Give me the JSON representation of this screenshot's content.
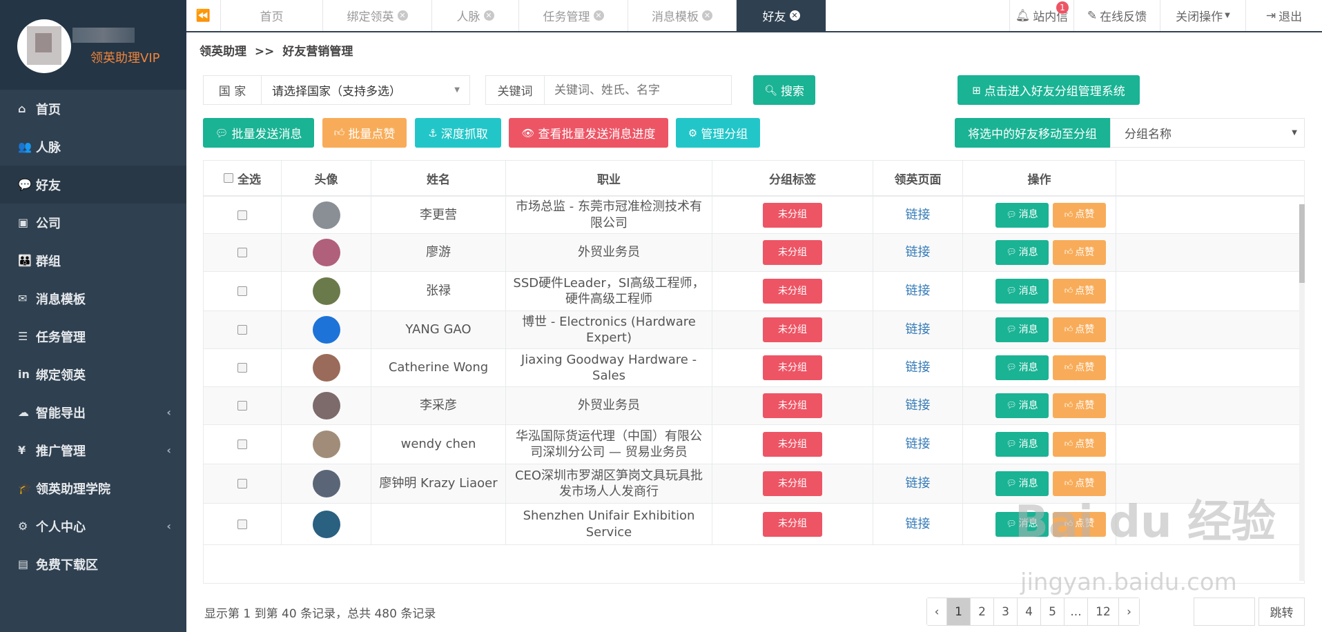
{
  "sidebar": {
    "brand_name": "领英助理VIP",
    "items": [
      {
        "label": "首页",
        "icon": "home-icon",
        "glyph": "⌂"
      },
      {
        "label": "人脉",
        "icon": "user-plus-icon",
        "glyph": "👥"
      },
      {
        "label": "好友",
        "icon": "comments-icon",
        "glyph": "💬",
        "active": true
      },
      {
        "label": "公司",
        "icon": "briefcase-icon",
        "glyph": "▣"
      },
      {
        "label": "群组",
        "icon": "users-icon",
        "glyph": "👪"
      },
      {
        "label": "消息模板",
        "icon": "envelope-icon",
        "glyph": "✉"
      },
      {
        "label": "任务管理",
        "icon": "tasks-icon",
        "glyph": "☰"
      },
      {
        "label": "绑定领英",
        "icon": "linkedin-icon",
        "glyph": "in"
      },
      {
        "label": "智能导出",
        "icon": "cloud-download-icon",
        "glyph": "☁",
        "chevron": true
      },
      {
        "label": "推广管理",
        "icon": "yen-icon",
        "glyph": "¥",
        "chevron": true
      },
      {
        "label": "领英助理学院",
        "icon": "graduation-cap-icon",
        "glyph": "🎓"
      },
      {
        "label": "个人中心",
        "icon": "gear-icon",
        "glyph": "⚙",
        "chevron": true
      },
      {
        "label": "免费下载区",
        "icon": "file-icon",
        "glyph": "▤"
      }
    ]
  },
  "tabs": {
    "back_icon": "⏪",
    "items": [
      "首页",
      "绑定领英",
      "人脉",
      "任务管理",
      "消息模板",
      "好友"
    ],
    "active": "好友",
    "notifications": {
      "label": "站内信",
      "count": "1"
    },
    "feedback": "在线反馈",
    "close_ops": "关闭操作",
    "logout": "退出"
  },
  "breadcrumb": {
    "root": "领英助理",
    "sep": ">>",
    "current": "好友营销管理"
  },
  "search": {
    "country_label": "国 家",
    "country_value": "请选择国家（支持多选）",
    "keyword_label": "关键词",
    "keyword_placeholder": "关键词、姓氏、名字",
    "search_button": "搜索",
    "group_system_button": "点击进入好友分组管理系统"
  },
  "actions": {
    "batch_message": "批量发送消息",
    "batch_like": "批量点赞",
    "deep_fetch": "深度抓取",
    "view_progress": "查看批量发送消息进度",
    "manage_groups": "管理分组",
    "move_to_group": "将选中的好友移动至分组",
    "group_select_value": "分组名称"
  },
  "table": {
    "headers": [
      "全选",
      "头像",
      "姓名",
      "职业",
      "分组标签",
      "领英页面",
      "操作"
    ],
    "tag_label": "未分组",
    "link_label": "链接",
    "message_label": "消息",
    "like_label": "点赞",
    "rows": [
      {
        "name": "李更营",
        "job": "市场总监 - 东莞市冠准检测技术有限公司",
        "avatar": "#8a8f96"
      },
      {
        "name": "廖游",
        "job": "外贸业务员",
        "avatar": "#b0607a"
      },
      {
        "name": "张禄",
        "job": "SSD硬件Leader，SI高级工程师，硬件高级工程师",
        "avatar": "#6b7a4a"
      },
      {
        "name": "YANG GAO",
        "job": "博世 - Electronics (Hardware Expert)",
        "avatar": "#1e73d8"
      },
      {
        "name": "Catherine Wong",
        "job": "Jiaxing Goodway Hardware - Sales",
        "avatar": "#9a6b5a"
      },
      {
        "name": "李采彦",
        "job": "外贸业务员",
        "avatar": "#7d6a6a"
      },
      {
        "name": "wendy chen",
        "job": "华泓国际货运代理（中国）有限公司深圳分公司 — 贸易业务员",
        "avatar": "#a08c78"
      },
      {
        "name": "廖钟明 Krazy Liaoer",
        "job": "CEO深圳市罗湖区笋岗文具玩具批发市场人人发商行",
        "avatar": "#5a6678"
      },
      {
        "name": "",
        "job": "Shenzhen Unifair Exhibition Service",
        "avatar": "#2a6080"
      }
    ]
  },
  "footer": {
    "info": "显示第 1 到第 40 条记录，总共 480 条记录",
    "pages": [
      "‹",
      "1",
      "2",
      "3",
      "4",
      "5",
      "...",
      "12",
      "›"
    ],
    "current_page": "1",
    "jump_label": "跳转"
  },
  "watermark": {
    "text": "Bai du 经验",
    "url": "jingyan.baidu.com"
  }
}
